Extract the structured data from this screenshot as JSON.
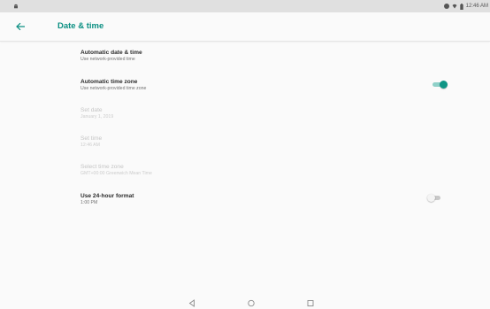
{
  "status_bar": {
    "time": "12:46 AM",
    "icons": [
      "android-icon",
      "circle-icon",
      "wifi-icon",
      "battery-icon"
    ]
  },
  "app_bar": {
    "title": "Date & time",
    "back_icon": "arrow-back-icon"
  },
  "settings": [
    {
      "title": "Automatic date & time",
      "subtitle": "Use network-provided time",
      "enabled": true
    },
    {
      "title": "Automatic time zone",
      "subtitle": "Use network-provided time zone",
      "enabled": true,
      "toggle": "on"
    },
    {
      "title": "Set date",
      "subtitle": "January 1, 2019",
      "enabled": false
    },
    {
      "title": "Set time",
      "subtitle": "12:46 AM",
      "enabled": false
    },
    {
      "title": "Select time zone",
      "subtitle": "GMT+00:00 Greenwich Mean Time",
      "enabled": false
    },
    {
      "title": "Use 24-hour format",
      "subtitle": "1:00 PM",
      "enabled": true,
      "toggle": "off"
    }
  ],
  "nav_bar": {
    "icons": [
      "back-triangle-icon",
      "home-circle-icon",
      "recents-square-icon"
    ]
  },
  "colors": {
    "accent": "#0a8f82",
    "toggle_on_thumb": "#0f9585",
    "toggle_on_track": "#8fd0c8"
  }
}
